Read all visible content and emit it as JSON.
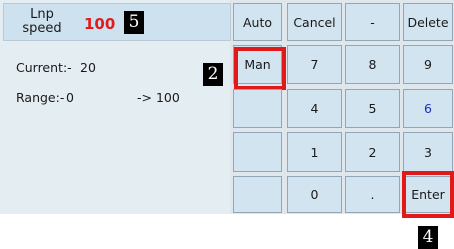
{
  "speed": {
    "label_line1": "Lnp",
    "label_line2": "speed",
    "value": "100"
  },
  "info": {
    "current_label": "Current:-",
    "current_value": "20",
    "range_label": "Range:-",
    "range_min": "0",
    "range_max": "-> 100"
  },
  "buttons": {
    "auto": "Auto",
    "cancel": "Cancel",
    "minus": "-",
    "delete": "Delete",
    "man": "Man",
    "seven": "7",
    "eight": "8",
    "nine": "9",
    "four": "4",
    "five": "5",
    "six": "6",
    "one": "1",
    "two": "2",
    "three": "3",
    "zero": "0",
    "dot": ".",
    "enter": "Enter"
  },
  "badges": {
    "speed": "5",
    "man": "2",
    "enter": "4"
  },
  "colors": {
    "speed_value": "#e21b1b",
    "highlight": "#e01a1a",
    "six_key": "#1d2fb5"
  }
}
